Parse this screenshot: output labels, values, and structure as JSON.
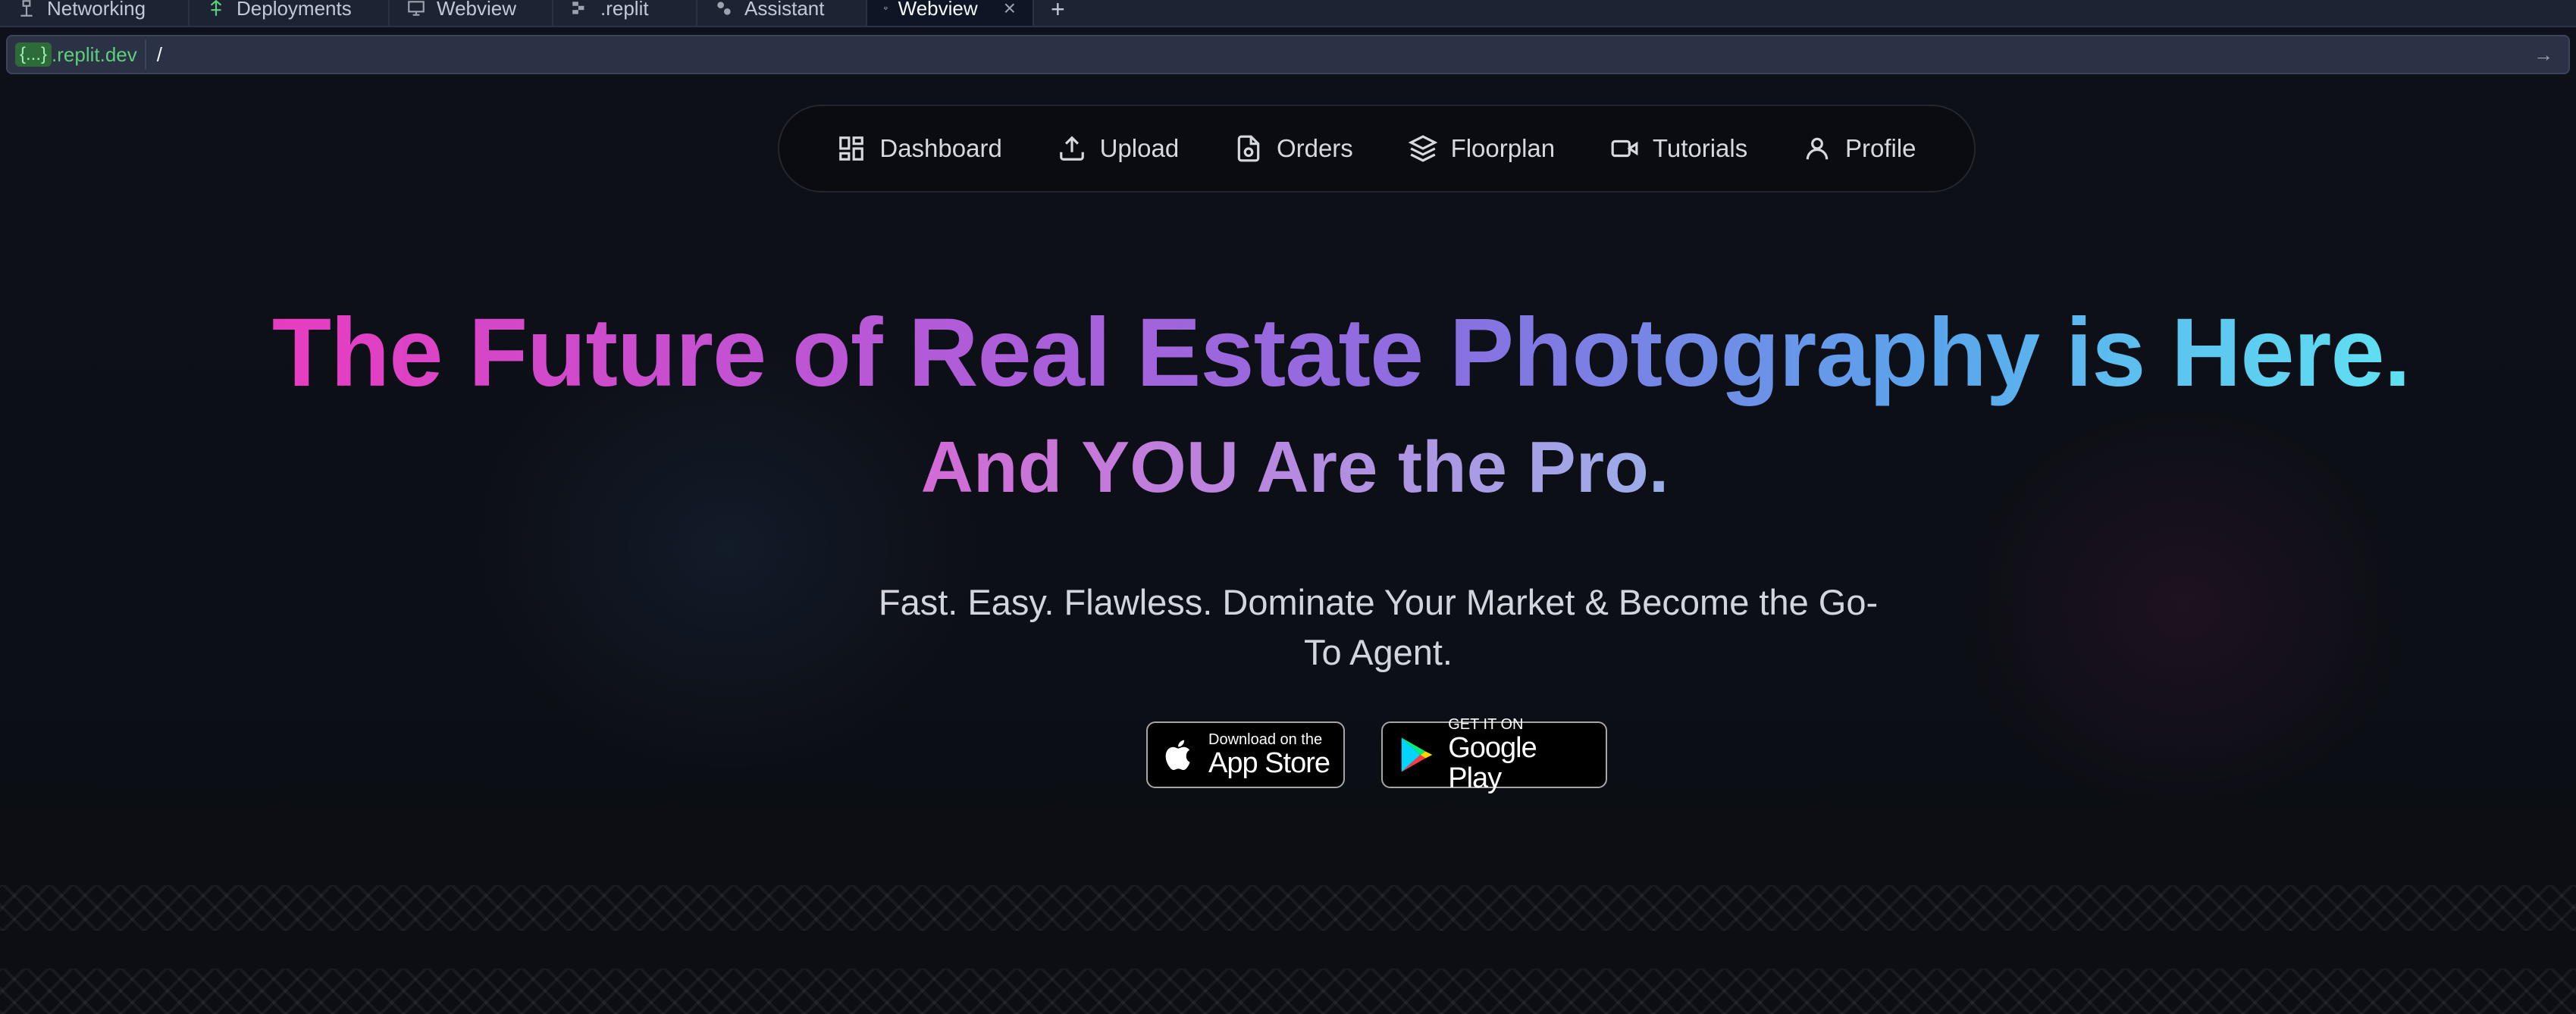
{
  "tabs": [
    {
      "label": "Networking",
      "icon": "network-icon"
    },
    {
      "label": "Deployments",
      "icon": "deployments-icon"
    },
    {
      "label": "Webview",
      "icon": "monitor-icon"
    },
    {
      "label": ".replit",
      "icon": "replit-file-icon"
    },
    {
      "label": "Assistant",
      "icon": "assistant-icon"
    },
    {
      "label": "Webview",
      "icon": "monitor-icon",
      "active": true
    }
  ],
  "urlbar": {
    "host_pill": "{...}",
    "host_suffix": ".replit.dev",
    "path": "/"
  },
  "nav": {
    "items": [
      {
        "label": "Dashboard",
        "icon": "dashboard-icon"
      },
      {
        "label": "Upload",
        "icon": "upload-icon"
      },
      {
        "label": "Orders",
        "icon": "orders-icon"
      },
      {
        "label": "Floorplan",
        "icon": "layers-icon"
      },
      {
        "label": "Tutorials",
        "icon": "video-icon"
      },
      {
        "label": "Profile",
        "icon": "user-icon"
      }
    ]
  },
  "hero": {
    "headline": "The Future of Real Estate Photography is Here.",
    "subheadline": "And YOU Are the Pro.",
    "tagline": "Fast. Easy. Flawless. Dominate Your Market & Become the Go-To Agent."
  },
  "badges": {
    "apple_small": "Download on the",
    "apple_big": "App Store",
    "google_small": "GET IT ON",
    "google_big": "Google Play"
  },
  "colors": {
    "page_bg": "#0e1119",
    "gradient_start": "#e83cc0",
    "gradient_end": "#5fe2f2"
  }
}
